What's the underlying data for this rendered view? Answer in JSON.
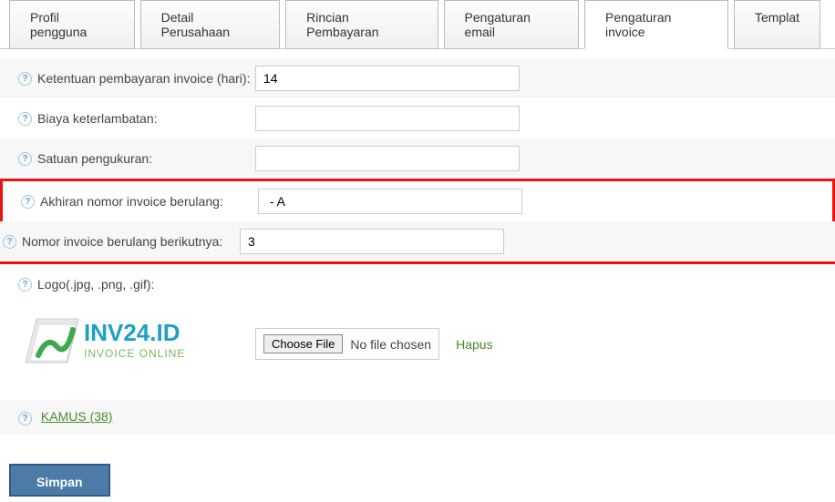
{
  "tabs": {
    "t0": "Profil pengguna",
    "t1": "Detail Perusahaan",
    "t2": "Rincian Pembayaran",
    "t3": "Pengaturan email",
    "t4": "Pengaturan invoice",
    "t5": "Templat"
  },
  "fields": {
    "ketentuan": {
      "label": "Ketentuan pembayaran invoice (hari):",
      "value": "14"
    },
    "biaya": {
      "label": "Biaya keterlambatan:",
      "value": ""
    },
    "satuan": {
      "label": "Satuan pengukuran:",
      "value": ""
    },
    "akhiran": {
      "label": "Akhiran nomor invoice berulang:",
      "value": " - A"
    },
    "nomor": {
      "label": "Nomor invoice berulang berikutnya:",
      "value": "3"
    },
    "logo": {
      "label": "Logo(.jpg, .png, .gif):"
    }
  },
  "logo_text": {
    "brand": "INV24.ID",
    "tagline": "INVOICE ONLINE"
  },
  "file": {
    "button": "Choose File",
    "status": "No file chosen",
    "hapus": "Hapus"
  },
  "kamus": "KAMUS (38)",
  "simpan": "Simpan",
  "help_glyph": "?"
}
